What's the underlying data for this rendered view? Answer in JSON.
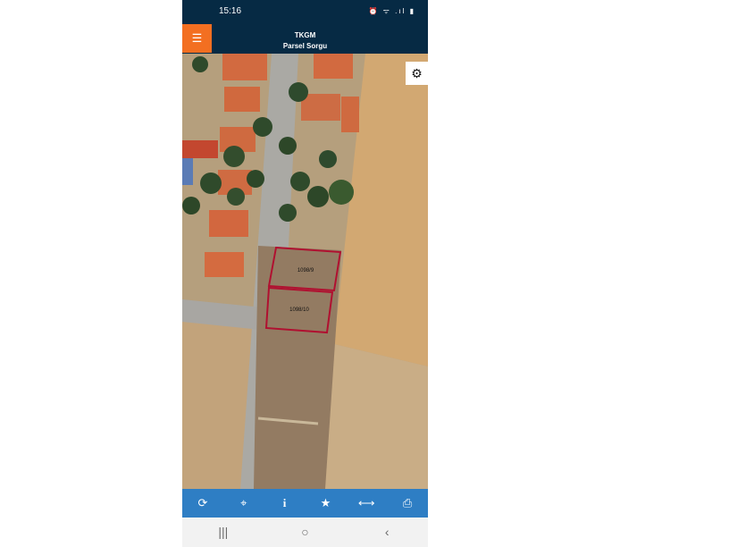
{
  "status_bar": {
    "time": "15:16",
    "icons": "⏰ ᯤ .ıl ▮"
  },
  "header": {
    "title": "TKGM",
    "subtitle": "Parsel Sorgu"
  },
  "menu_icon": "hamburger-menu-icon",
  "settings_icon": "gear-icon",
  "parcels": [
    {
      "label": "1098/9"
    },
    {
      "label": "1098/10"
    }
  ],
  "toolbar": [
    {
      "icon": "refresh-icon",
      "glyph": "⟳"
    },
    {
      "icon": "locate-icon",
      "glyph": "⌖"
    },
    {
      "icon": "info-icon",
      "glyph": "i"
    },
    {
      "icon": "star-icon",
      "glyph": "★"
    },
    {
      "icon": "measure-icon",
      "glyph": "⟷"
    },
    {
      "icon": "print-icon",
      "glyph": "⎙"
    }
  ],
  "navbar": [
    {
      "icon": "recent-apps-icon",
      "glyph": "|||"
    },
    {
      "icon": "home-icon",
      "glyph": "○"
    },
    {
      "icon": "back-icon",
      "glyph": "‹"
    }
  ],
  "colors": {
    "header_bg": "#062a44",
    "menu_button": "#f36f21",
    "toolbar_bg": "#2e7ec4",
    "parcel_outline": "#b01030"
  }
}
